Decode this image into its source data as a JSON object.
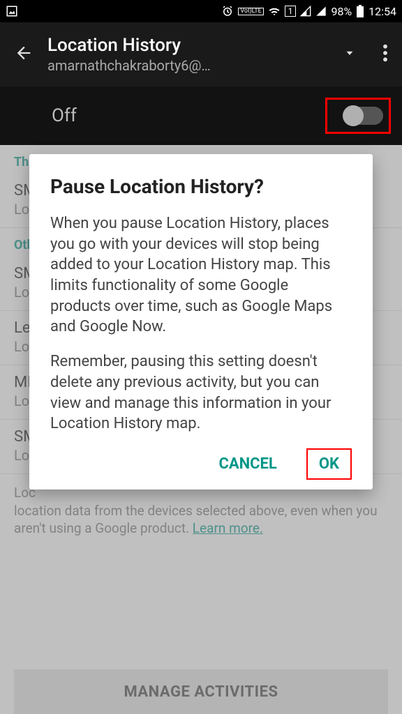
{
  "status": {
    "battery": "98%",
    "time": "12:54",
    "lte_badge": "LTE",
    "sim_badge": "1"
  },
  "header": {
    "title": "Location History",
    "subtitle": "amarnathchakraborty6@…"
  },
  "toggle": {
    "state_label": "Off"
  },
  "sections": {
    "this_device": "This device",
    "other_devices": "Other devices"
  },
  "devices": [
    {
      "name": "SM",
      "sub": "Loc"
    },
    {
      "name": "SM",
      "sub": "Loc"
    },
    {
      "name": "Le",
      "sub": "Loc"
    },
    {
      "name": "MI",
      "sub": "Loc"
    },
    {
      "name": "SM",
      "sub": "Loc"
    }
  ],
  "info": {
    "text_prefix": "Loc",
    "text_rest": "location data from the devices selected above, even when you aren't using a Google product. ",
    "learn_more": "Learn more."
  },
  "manage_button": "MANAGE ACTIVITIES",
  "dialog": {
    "title": "Pause Location History?",
    "para1": "When you pause Location History, places you go with your devices will stop being added to your Location History map. This limits functionality of some Google products over time, such as Google Maps and Google Now.",
    "para2": "Remember, pausing this setting doesn't delete any previous activity, but you can view and manage this information in your Location History map.",
    "cancel": "CANCEL",
    "ok": "OK"
  },
  "icons": {
    "picture": "picture-icon",
    "alarm": "alarm-icon",
    "volte": "volte-icon",
    "wifi": "wifi-icon",
    "sim": "sim-icon",
    "signal1": "signal-icon",
    "signal2": "signal-icon",
    "battery": "battery-icon",
    "back": "back-arrow-icon",
    "dropdown": "chevron-down-icon",
    "menu": "more-vert-icon"
  }
}
